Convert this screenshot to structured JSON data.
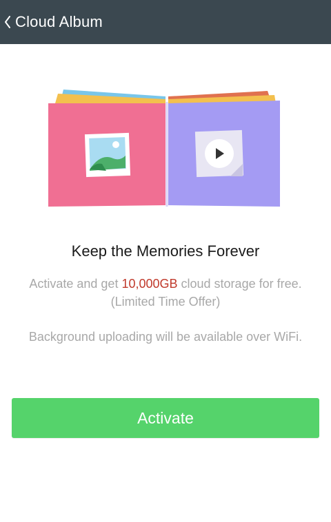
{
  "header": {
    "title": "Cloud Album",
    "back_icon": "chevron-left-icon",
    "background": "#3b4850"
  },
  "illustration": {
    "left_page_icon": "image-icon",
    "right_page_icon": "play-icon",
    "left_page_color": "#f06f93",
    "right_page_color": "#a49bf3"
  },
  "content": {
    "headline": "Keep the Memories Forever",
    "desc1_prefix": "Activate and get ",
    "desc1_highlight": "10,000GB",
    "desc1_suffix": " cloud storage for free. (Limited Time Offer)",
    "desc2": "Background uploading will be available over WiFi.",
    "highlight_color": "#c0392b"
  },
  "actions": {
    "activate_label": "Activate",
    "activate_color": "#55d36b"
  }
}
